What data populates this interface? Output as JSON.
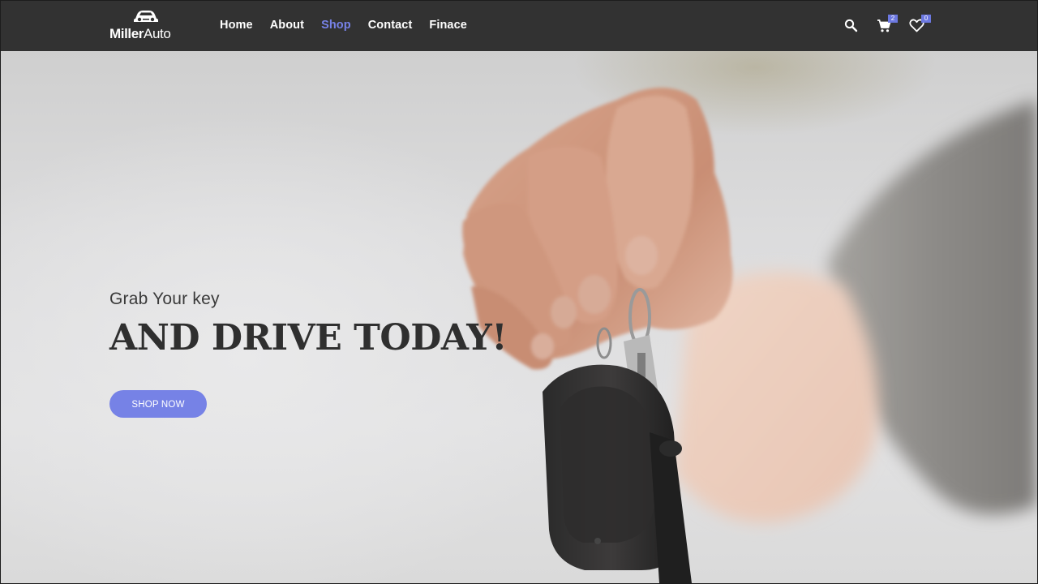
{
  "brand": {
    "name_bold": "Miller",
    "name_light": "Auto",
    "icon": "car-logo-icon"
  },
  "nav": {
    "links": [
      {
        "label": "Home",
        "active": false
      },
      {
        "label": "About",
        "active": false
      },
      {
        "label": "Shop",
        "active": true
      },
      {
        "label": "Contact",
        "active": false
      },
      {
        "label": "Finace",
        "active": false
      }
    ],
    "search_icon": "search-icon",
    "cart": {
      "icon": "cart-icon",
      "count": "2"
    },
    "wishlist": {
      "icon": "heart-icon",
      "count": "0"
    }
  },
  "hero": {
    "subtitle": "Grab Your key",
    "headline": "AND DRIVE TODAY!",
    "cta_label": "SHOP NOW",
    "image": "hand-holding-car-key"
  },
  "colors": {
    "navbar_bg": "#323232",
    "accent": "#7682e6",
    "active_link": "#7782e8",
    "heading": "#2f2f2f"
  }
}
